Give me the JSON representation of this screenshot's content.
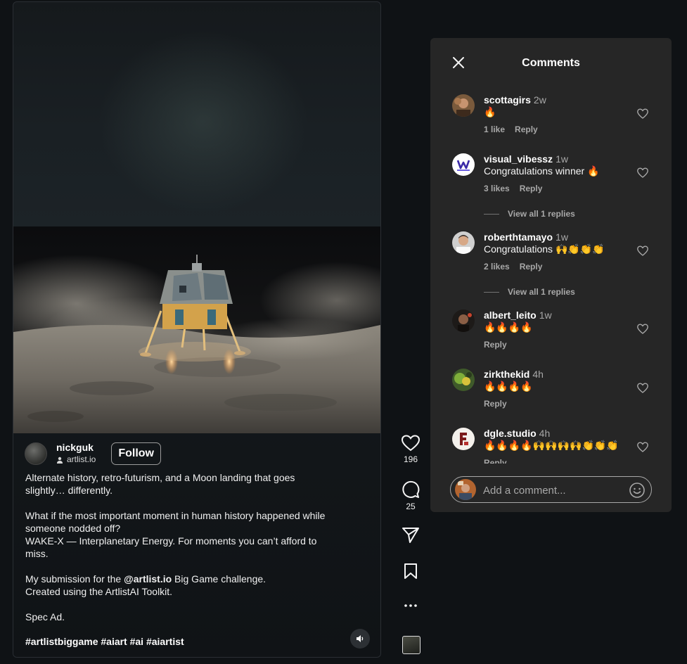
{
  "post": {
    "author": {
      "username": "nickguk",
      "subtitle": "artlist.io",
      "follow_label": "Follow"
    },
    "caption": {
      "p1": "Alternate history, retro-futurism, and a Moon landing that goes slightly… differently.",
      "p2": "What if the most important moment in human history happened while someone nodded off?\nWAKE-X — Interplanetary Energy. For moments you can’t afford to miss.",
      "p3_before": "My submission for the ",
      "p3_mention": "@artlist.io",
      "p3_after": " Big Game challenge.\nCreated using the ArtlistAI Toolkit.",
      "p4": "Spec Ad.",
      "hashtags": "#artlistbiggame #aiart #ai #aiartist"
    }
  },
  "rail": {
    "like_count": "196",
    "comment_count": "25"
  },
  "comments_panel": {
    "title": "Comments",
    "items": [
      {
        "user": "scottagirs",
        "time": "2w",
        "text": "🔥",
        "likes": "1 like",
        "reply": "Reply"
      },
      {
        "user": "visual_vibessz",
        "time": "1w",
        "text": "Congratulations winner 🔥",
        "likes": "3 likes",
        "reply": "Reply",
        "view_replies": "View all 1 replies"
      },
      {
        "user": "roberthtamayo",
        "time": "1w",
        "text": "Congratulations 🙌👏👏👏",
        "likes": "2 likes",
        "reply": "Reply",
        "view_replies": "View all 1 replies"
      },
      {
        "user": "albert_leito",
        "time": "1w",
        "text": "🔥🔥🔥🔥",
        "reply": "Reply"
      },
      {
        "user": "zirkthekid",
        "time": "4h",
        "text": "🔥🔥🔥🔥",
        "reply": "Reply"
      },
      {
        "user": "dgle.studio",
        "time": "4h",
        "text": "🔥🔥🔥🔥🙌🙌🙌🙌👏👏👏",
        "reply": "Reply"
      }
    ],
    "add_comment_placeholder": "Add a comment..."
  },
  "icons": {
    "close": "close-icon",
    "heart": "heart-icon",
    "comment": "comment-bubble-icon",
    "share": "paper-plane-icon",
    "save": "bookmark-icon",
    "more": "more-dots-icon",
    "sound": "speaker-icon",
    "emoji": "emoji-icon"
  }
}
